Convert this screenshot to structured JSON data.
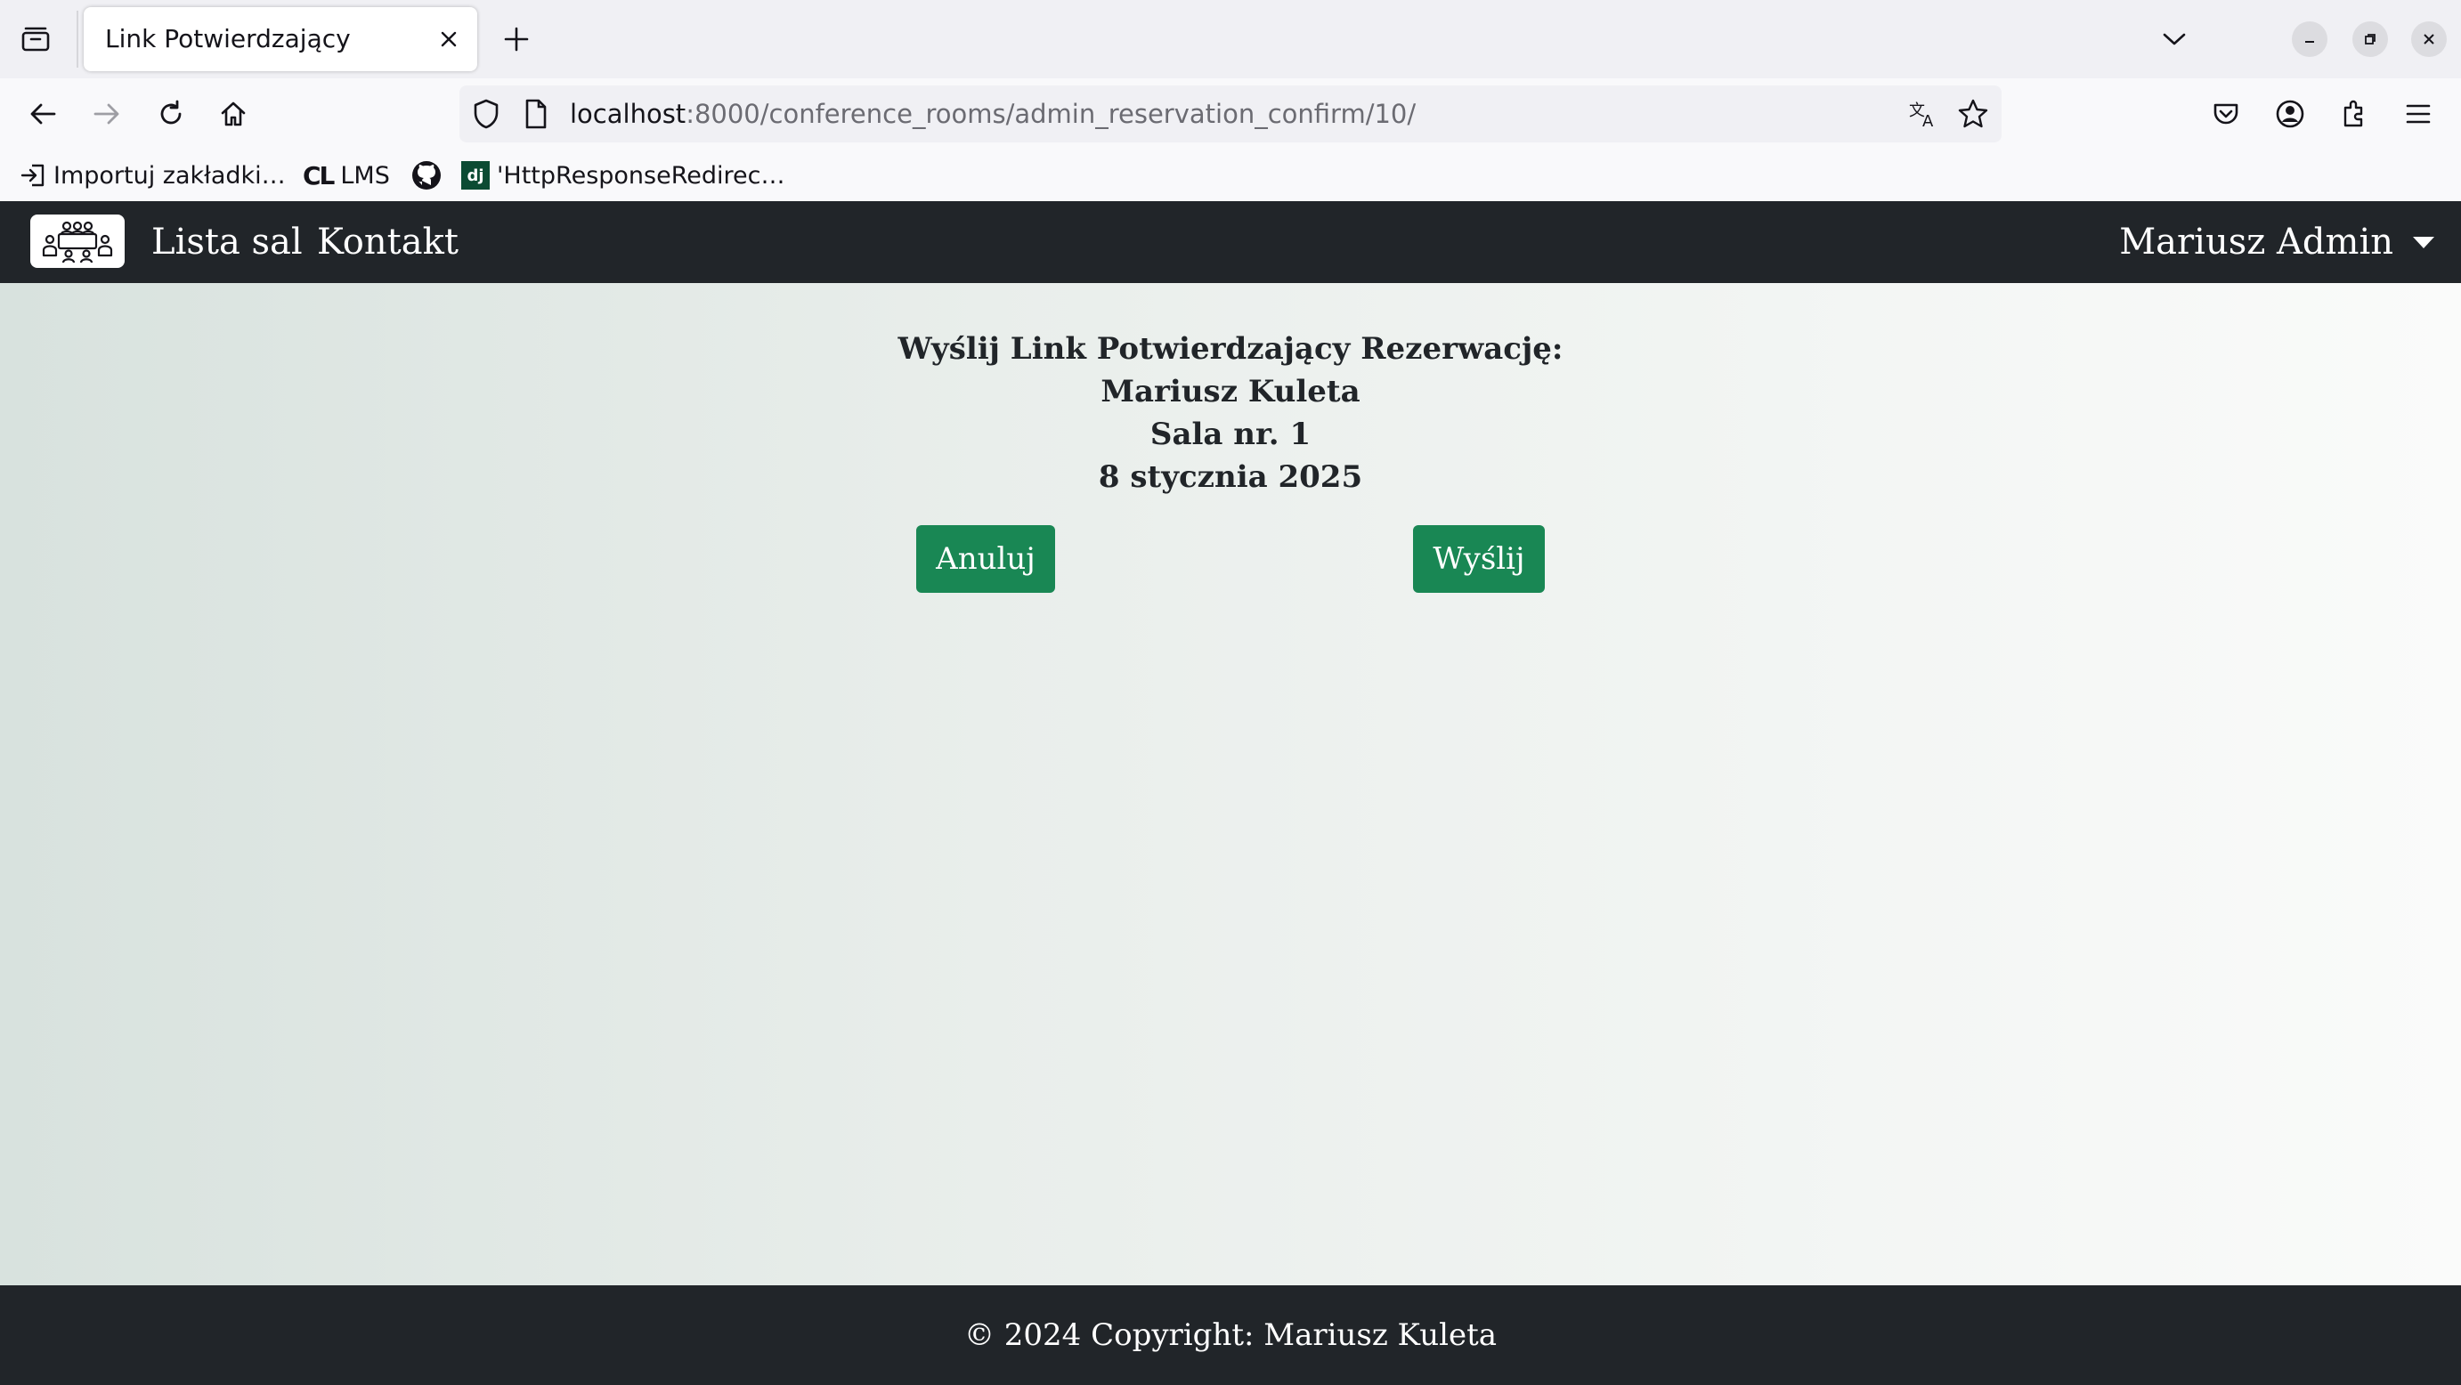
{
  "browser": {
    "tab_title": "Link Potwierdzający",
    "url_host": "localhost",
    "url_rest": ":8000/conference_rooms/admin_reservation_confirm/10/",
    "bookmarks": [
      {
        "label": "Importuj zakładki…",
        "icon": "import-icon"
      },
      {
        "label": "LMS",
        "icon": "cl-logo-icon",
        "icon_text": "CL"
      },
      {
        "label": "",
        "icon": "github-icon"
      },
      {
        "label": "'HttpResponseRedirec…",
        "icon": "django-icon",
        "icon_text": "dj"
      }
    ]
  },
  "site_nav": {
    "logo": "conference-room-logo",
    "links": [
      "Lista sal",
      "Kontakt"
    ],
    "user": "Mariusz Admin"
  },
  "confirm": {
    "heading": "Wyślij Link Potwierdzający Rezerwację:",
    "person": "Mariusz Kuleta",
    "room": "Sala nr. 1",
    "date": "8 stycznia 2025",
    "cancel_label": "Anuluj",
    "send_label": "Wyślij"
  },
  "footer": {
    "text": "© 2024 Copyright: Mariusz Kuleta"
  },
  "colors": {
    "nav_bg": "#212529",
    "button_green": "#198754"
  }
}
